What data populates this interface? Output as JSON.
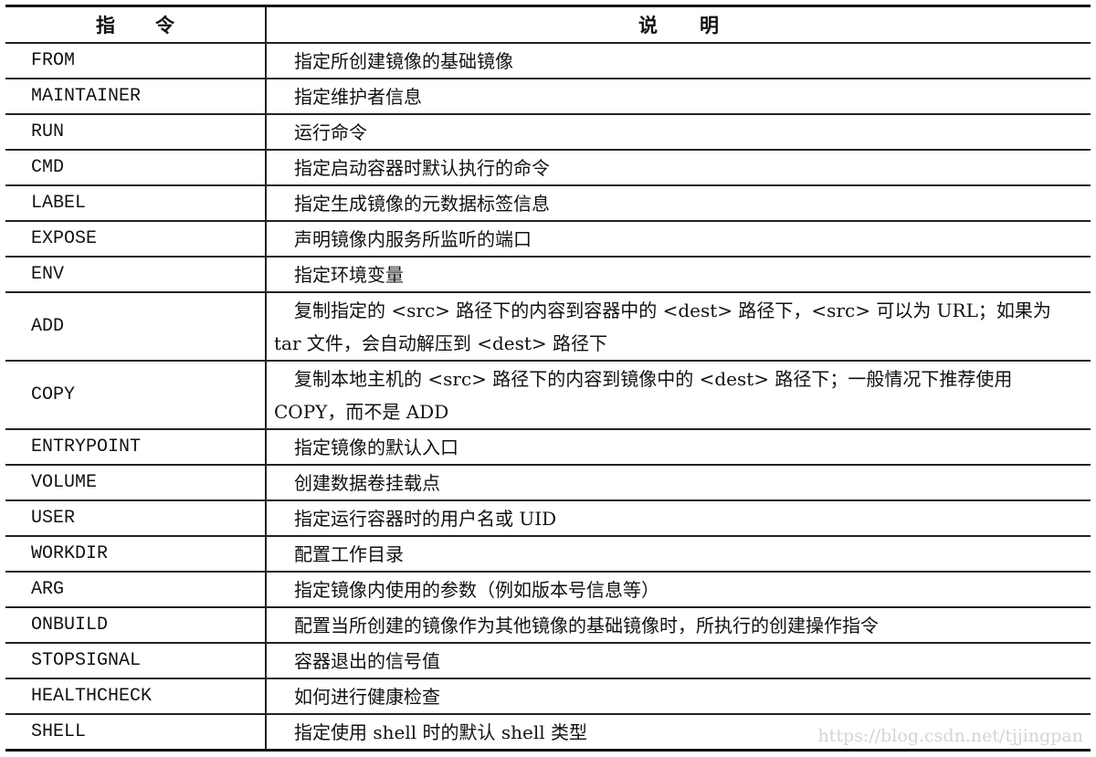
{
  "header": {
    "col1": "指令",
    "col2": "说明"
  },
  "rows": [
    {
      "cmd": "FROM",
      "desc": "指定所创建镜像的基础镜像"
    },
    {
      "cmd": "MAINTAINER",
      "desc": "指定维护者信息"
    },
    {
      "cmd": "RUN",
      "desc": "运行命令"
    },
    {
      "cmd": "CMD",
      "desc": "指定启动容器时默认执行的命令"
    },
    {
      "cmd": "LABEL",
      "desc": "指定生成镜像的元数据标签信息"
    },
    {
      "cmd": "EXPOSE",
      "desc": "声明镜像内服务所监听的端口"
    },
    {
      "cmd": "ENV",
      "desc": "指定环境变量"
    },
    {
      "cmd": "ADD",
      "desc": "复制指定的 <src> 路径下的内容到容器中的 <dest> 路径下，<src> 可以为 URL；如果为 tar 文件，会自动解压到 <dest> 路径下"
    },
    {
      "cmd": "COPY",
      "desc": "复制本地主机的 <src> 路径下的内容到镜像中的 <dest> 路径下；一般情况下推荐使用 COPY，而不是 ADD"
    },
    {
      "cmd": "ENTRYPOINT",
      "desc": "指定镜像的默认入口"
    },
    {
      "cmd": "VOLUME",
      "desc": "创建数据卷挂载点"
    },
    {
      "cmd": "USER",
      "desc": "指定运行容器时的用户名或 UID"
    },
    {
      "cmd": "WORKDIR",
      "desc": "配置工作目录"
    },
    {
      "cmd": "ARG",
      "desc": "指定镜像内使用的参数（例如版本号信息等）"
    },
    {
      "cmd": "ONBUILD",
      "desc": "配置当所创建的镜像作为其他镜像的基础镜像时，所执行的创建操作指令"
    },
    {
      "cmd": "STOPSIGNAL",
      "desc": "容器退出的信号值"
    },
    {
      "cmd": "HEALTHCHECK",
      "desc": "如何进行健康检查"
    },
    {
      "cmd": "SHELL",
      "desc": "指定使用 shell 时的默认 shell 类型"
    }
  ],
  "watermark": "https://blog.csdn.net/tjjingpan"
}
